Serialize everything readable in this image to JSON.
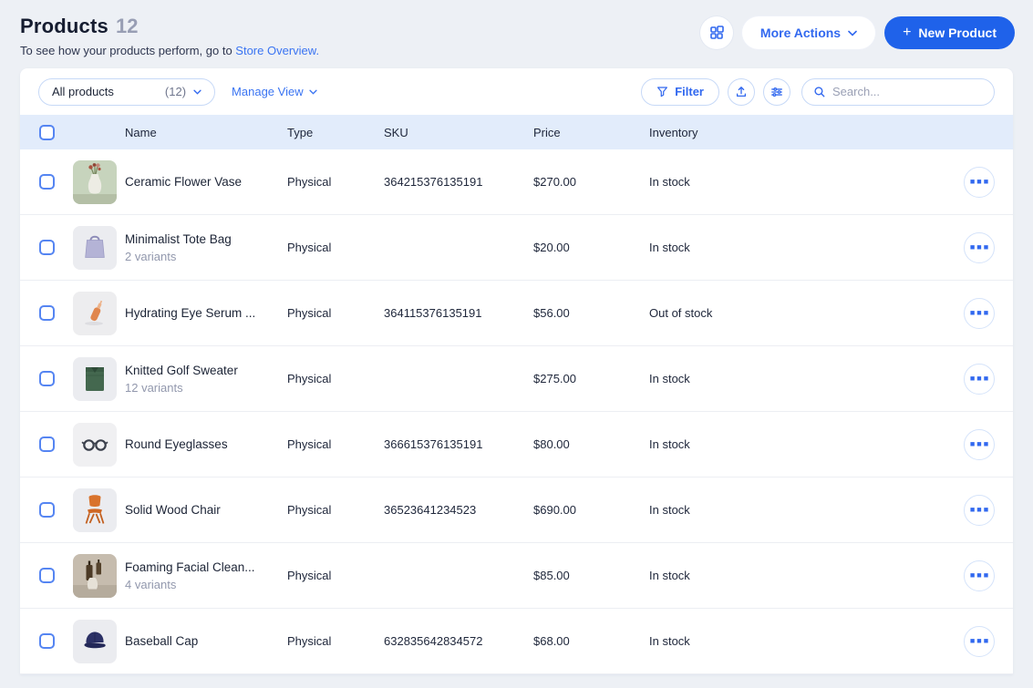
{
  "page": {
    "title": "Products",
    "count": "12",
    "subtitle_prefix": "To see how your products perform, go to ",
    "subtitle_link": "Store Overview."
  },
  "header_actions": {
    "grid_button_icon": "grid-apps-icon",
    "more_actions_label": "More Actions",
    "new_product_plus": "+",
    "new_product_label": "New Product"
  },
  "toolbar": {
    "view_selector_label": "All products",
    "view_selector_count": "(12)",
    "manage_view_label": "Manage View",
    "filter_label": "Filter",
    "upload_button_icon": "upload-icon",
    "adjust_button_icon": "sliders-icon",
    "search_placeholder": "Search..."
  },
  "table": {
    "columns": [
      "Name",
      "Type",
      "SKU",
      "Price",
      "Inventory"
    ],
    "rows": [
      {
        "image": "ceramic-flower-vase-photo",
        "name": "Ceramic Flower Vase",
        "variants": "",
        "type": "Physical",
        "sku": "364215376135191",
        "price": "$270.00",
        "inventory": "In stock"
      },
      {
        "image": "minimalist-tote-bag-photo",
        "name": "Minimalist Tote Bag",
        "variants": "2 variants",
        "type": "Physical",
        "sku": "",
        "price": "$20.00",
        "inventory": "In stock"
      },
      {
        "image": "hydrating-eye-serum-photo",
        "name": "Hydrating Eye Serum ...",
        "variants": "",
        "type": "Physical",
        "sku": "364115376135191",
        "price": "$56.00",
        "inventory": "Out of stock"
      },
      {
        "image": "knitted-golf-sweater-photo",
        "name": "Knitted Golf Sweater",
        "variants": "12 variants",
        "type": "Physical",
        "sku": "",
        "price": "$275.00",
        "inventory": "In stock"
      },
      {
        "image": "round-eyeglasses-photo",
        "name": "Round Eyeglasses",
        "variants": "",
        "type": "Physical",
        "sku": "366615376135191",
        "price": "$80.00",
        "inventory": "In stock"
      },
      {
        "image": "solid-wood-chair-photo",
        "name": "Solid Wood Chair",
        "variants": "",
        "type": "Physical",
        "sku": "36523641234523",
        "price": "$690.00",
        "inventory": "In stock"
      },
      {
        "image": "foaming-facial-cleanser-photo",
        "name": "Foaming Facial Clean...",
        "variants": "4 variants",
        "type": "Physical",
        "sku": "",
        "price": "$85.00",
        "inventory": "In stock"
      },
      {
        "image": "baseball-cap-photo",
        "name": "Baseball Cap",
        "variants": "",
        "type": "Physical",
        "sku": "632835642834572",
        "price": "$68.00",
        "inventory": "In stock"
      }
    ]
  },
  "colors": {
    "page_background": "#edf0f5",
    "card_background": "#ffffff",
    "table_header_background": "#e2ecfb",
    "accent_blue": "#1f62ea",
    "link_blue": "#3a74f2",
    "text_dark": "#1c2436",
    "text_secondary": "#9298ad",
    "pill_border": "#c7d9f7"
  }
}
